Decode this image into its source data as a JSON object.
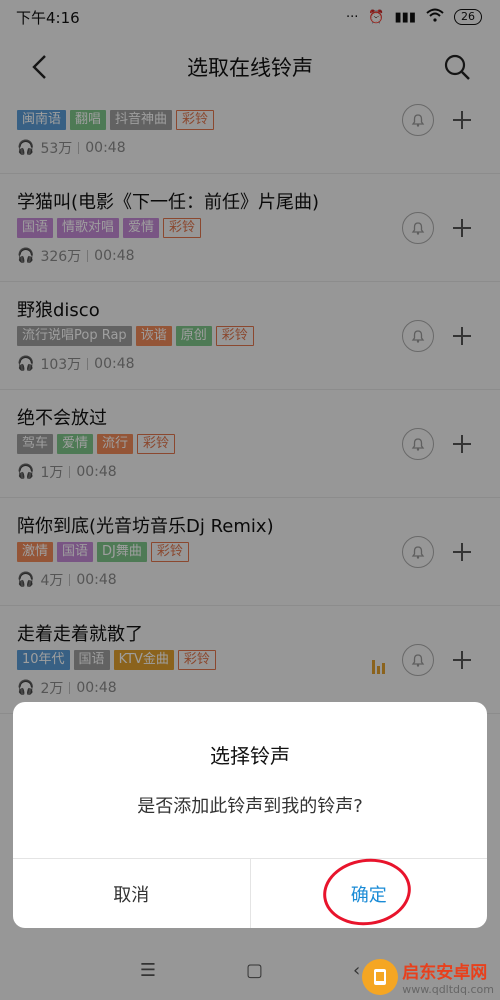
{
  "status": {
    "time": "下午4:16",
    "battery": "26"
  },
  "header": {
    "title": "选取在线铃声"
  },
  "songs": [
    {
      "title": "",
      "tags": [
        "闽南语",
        "翻唱",
        "抖音神曲"
      ],
      "tag_colors": [
        "#5b9bd5",
        "#7ec58a",
        "#9e9e9e"
      ],
      "ring_tag": "彩铃",
      "plays": "53万",
      "duration": "00:48"
    },
    {
      "title": "学猫叫(电影《下一任：前任》片尾曲)",
      "tags": [
        "国语",
        "情歌对唱",
        "爱情"
      ],
      "tag_colors": [
        "#c48ad6",
        "#c48ad6",
        "#c48ad6"
      ],
      "ring_tag": "彩铃",
      "plays": "326万",
      "duration": "00:48"
    },
    {
      "title": "野狼disco",
      "tags": [
        "流行说唱Pop Rap",
        "诙谐",
        "原创"
      ],
      "tag_colors": [
        "#9e9e9e",
        "#ef8a5a",
        "#7ec58a"
      ],
      "ring_tag": "彩铃",
      "plays": "103万",
      "duration": "00:48"
    },
    {
      "title": "绝不会放过",
      "tags": [
        "驾车",
        "爱情",
        "流行"
      ],
      "tag_colors": [
        "#9e9e9e",
        "#7ec58a",
        "#ef8a5a"
      ],
      "ring_tag": "彩铃",
      "plays": "1万",
      "duration": "00:48"
    },
    {
      "title": "陪你到底(光音坊音乐Dj Remix)",
      "tags": [
        "激情",
        "国语",
        "DJ舞曲"
      ],
      "tag_colors": [
        "#ef8a5a",
        "#c48ad6",
        "#7ec58a"
      ],
      "ring_tag": "彩铃",
      "plays": "4万",
      "duration": "00:48"
    },
    {
      "title": "走着走着就散了",
      "tags": [
        "10年代",
        "国语",
        "KTV金曲"
      ],
      "tag_colors": [
        "#5b9bd5",
        "#9e9e9e",
        "#e0a12f"
      ],
      "ring_tag": "彩铃",
      "plays": "2万",
      "duration": "00:48"
    }
  ],
  "dialog": {
    "title": "选择铃声",
    "message": "是否添加此铃声到我的铃声?",
    "cancel": "取消",
    "confirm": "确定"
  },
  "watermark": {
    "name": "启东安卓网",
    "url": "www.qdltdq.com"
  }
}
